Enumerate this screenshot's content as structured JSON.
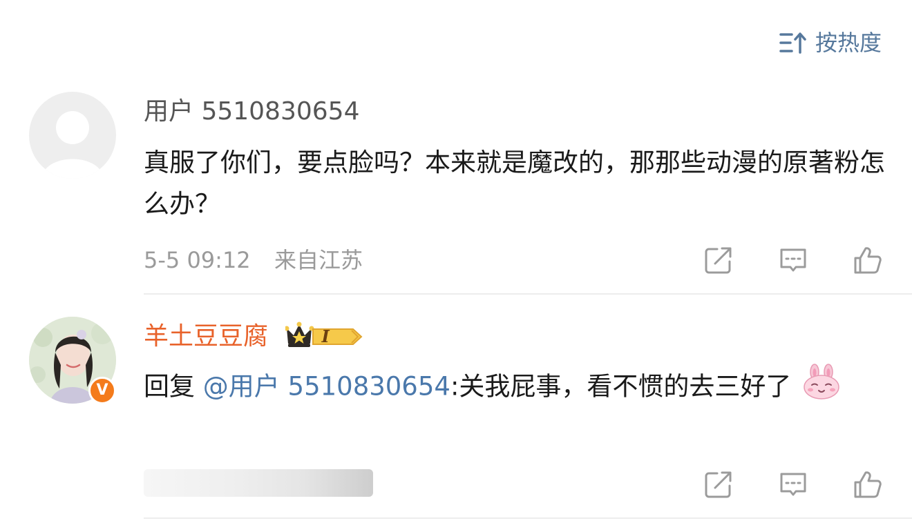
{
  "sort": {
    "label": "按热度",
    "icon": "sort-icon"
  },
  "comments": [
    {
      "username": "用户 5510830654",
      "avatar": "default-avatar",
      "text": "真服了你们，要点脸吗？本来就是魔改的，那那些动漫的原著粉怎么办？",
      "date": "5-5 09:12",
      "location": "来自江苏",
      "actions": [
        "share-icon",
        "comment-icon",
        "like-icon"
      ]
    },
    {
      "username": "羊土豆豆腐",
      "avatar": "user-photo-avatar",
      "verified_badge": "V",
      "level_badge": "I",
      "reply_prefix": "回复 ",
      "mention": "@用户 5510830654",
      "text_after_mention": ":关我屁事，看不惯的去三好了",
      "emoji": "bunny-emoji",
      "actions": [
        "share-icon",
        "comment-icon",
        "like-icon"
      ]
    }
  ],
  "colors": {
    "link": "#56789c",
    "vip_name": "#e8622a",
    "meta": "#9a9a9a",
    "badge_orange": "#f47b1b"
  }
}
